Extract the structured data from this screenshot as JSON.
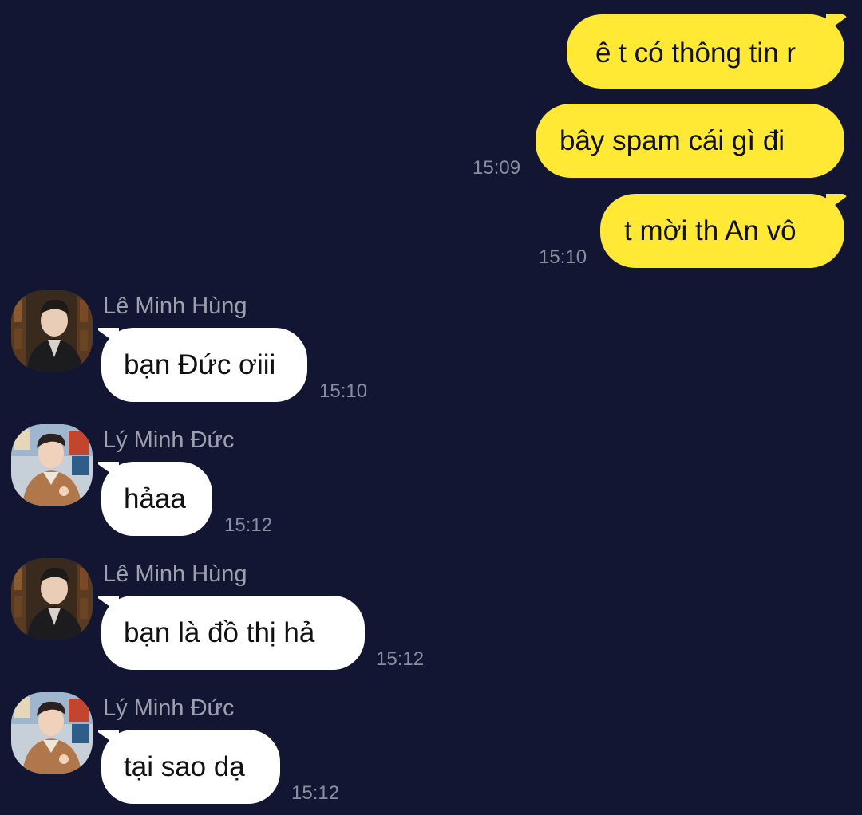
{
  "outgoing": [
    {
      "text": "ê t có thông tin r",
      "time": ""
    },
    {
      "text": "bây spam cái gì đi",
      "time": "15:09"
    },
    {
      "text": "t mời th An vô",
      "time": "15:10"
    }
  ],
  "incoming": [
    {
      "sender": "Lê Minh Hùng",
      "text": "bạn Đức ơiii",
      "time": "15:10"
    },
    {
      "sender": "Lý Minh Đức",
      "text": "hảaa",
      "time": "15:12"
    },
    {
      "sender": "Lê Minh Hùng",
      "text": "bạn là đồ thị hả",
      "time": "15:12"
    },
    {
      "sender": "Lý Minh Đức",
      "text": "tại sao dạ",
      "time": "15:12"
    }
  ],
  "colors": {
    "background": "#131633",
    "outgoing_bubble": "#ffe935",
    "incoming_bubble": "#ffffff",
    "timestamp": "#8b8e9e",
    "sender_name": "#9ea0ad"
  }
}
